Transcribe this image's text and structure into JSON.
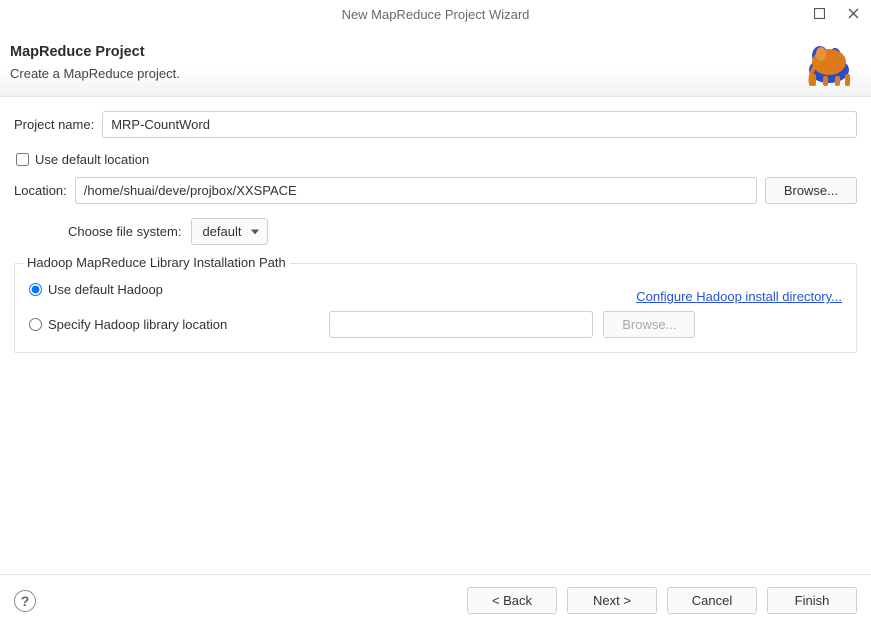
{
  "titlebar": {
    "title": "New MapReduce Project Wizard"
  },
  "header": {
    "heading": "MapReduce Project",
    "subtitle": "Create a MapReduce project."
  },
  "fields": {
    "projectNameLabel": "Project name:",
    "projectNameValue": "MRP-CountWord",
    "useDefaultLocationLabel": "Use default location",
    "locationLabel": "Location:",
    "locationValue": "/home/shuai/deve/projbox/XXSPACE",
    "browseLabel": "Browse...",
    "chooseFileSystemLabel": "Choose file system:",
    "fileSystemValue": "default"
  },
  "hadoopGroup": {
    "title": "Hadoop MapReduce Library Installation Path",
    "useDefaultLabel": "Use default Hadoop",
    "specifyLabel": "Specify Hadoop library location",
    "configureLink": "Configure Hadoop install directory...",
    "specifyValue": "",
    "browseLabel": "Browse..."
  },
  "footer": {
    "back": "< Back",
    "next": "Next >",
    "cancel": "Cancel",
    "finish": "Finish"
  }
}
